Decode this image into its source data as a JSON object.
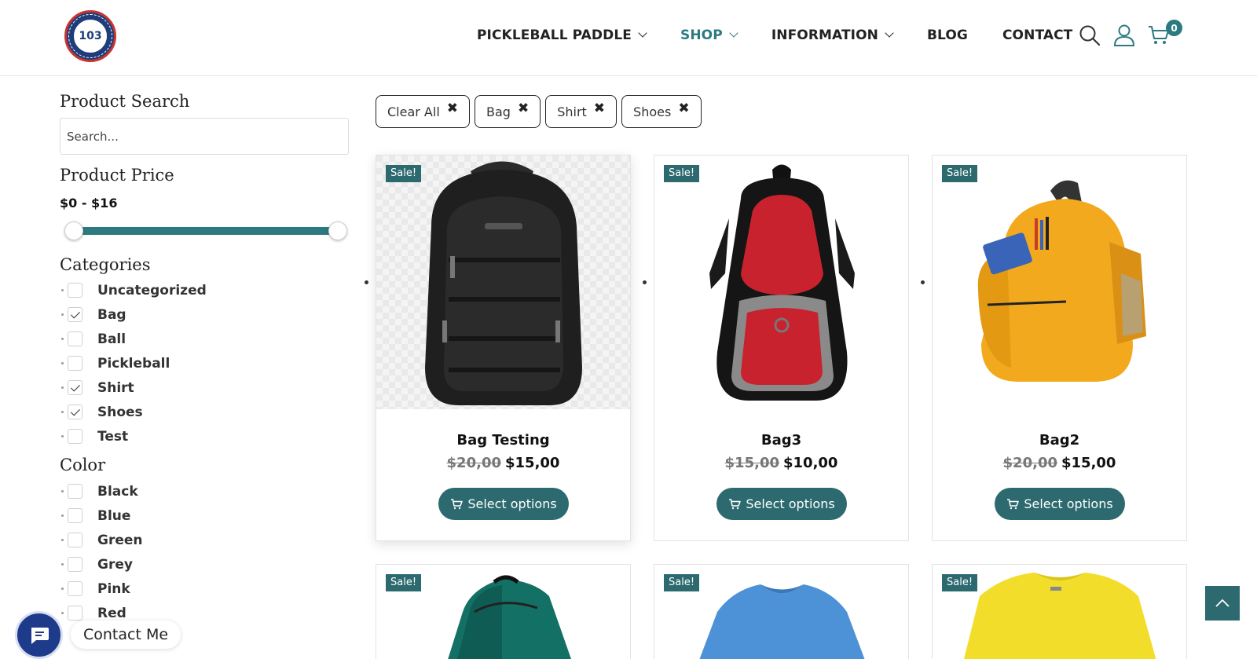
{
  "brand": {
    "logo_text": "103"
  },
  "nav": {
    "items": [
      {
        "label": "PICKLEBALL PADDLE"
      },
      {
        "label": "SHOP"
      },
      {
        "label": "INFORMATION"
      },
      {
        "label": "BLOG"
      },
      {
        "label": "CONTACT"
      }
    ],
    "cart_count": "0"
  },
  "sidebar": {
    "search_title": "Product Search",
    "search_placeholder": "Search...",
    "price_title": "Product Price",
    "price_range": "$0 - $16",
    "price_min_value": 0,
    "price_max_value": 16,
    "categories_title": "Categories",
    "categories": [
      {
        "label": "Uncategorized",
        "checked": false
      },
      {
        "label": "Bag",
        "checked": true
      },
      {
        "label": "Ball",
        "checked": false
      },
      {
        "label": "Pickleball",
        "checked": false
      },
      {
        "label": "Shirt",
        "checked": true
      },
      {
        "label": "Shoes",
        "checked": true
      },
      {
        "label": "Test",
        "checked": false
      }
    ],
    "color_title": "Color",
    "colors": [
      {
        "label": "Black",
        "checked": false
      },
      {
        "label": "Blue",
        "checked": false
      },
      {
        "label": "Green",
        "checked": false
      },
      {
        "label": "Grey",
        "checked": false
      },
      {
        "label": "Pink",
        "checked": false
      },
      {
        "label": "Red",
        "checked": false
      }
    ]
  },
  "filters": {
    "chips": [
      {
        "label": "Clear All"
      },
      {
        "label": "Bag"
      },
      {
        "label": "Shirt"
      },
      {
        "label": "Shoes"
      }
    ],
    "remove_glyph": "✖"
  },
  "products": [
    {
      "sale_badge": "Sale!",
      "name": "Bag Testing",
      "old_price": "$20,00",
      "price": "$15,00",
      "button": "Select options",
      "image": "black-backpack"
    },
    {
      "sale_badge": "Sale!",
      "name": "Bag3",
      "old_price": "$15,00",
      "price": "$10,00",
      "button": "Select options",
      "image": "red-black-backpack"
    },
    {
      "sale_badge": "Sale!",
      "name": "Bag2",
      "old_price": "$20,00",
      "price": "$15,00",
      "button": "Select options",
      "image": "yellow-backpack"
    },
    {
      "sale_badge": "Sale!",
      "image": "green-backpack"
    },
    {
      "sale_badge": "Sale!",
      "image": "blue-tshirt"
    },
    {
      "sale_badge": "Sale!",
      "image": "yellow-tshirt"
    }
  ],
  "floating": {
    "contact_label": "Contact Me"
  },
  "colors": {
    "accent": "#2c7a80",
    "button": "#2c6a6f",
    "contact": "#1e3a8a"
  }
}
